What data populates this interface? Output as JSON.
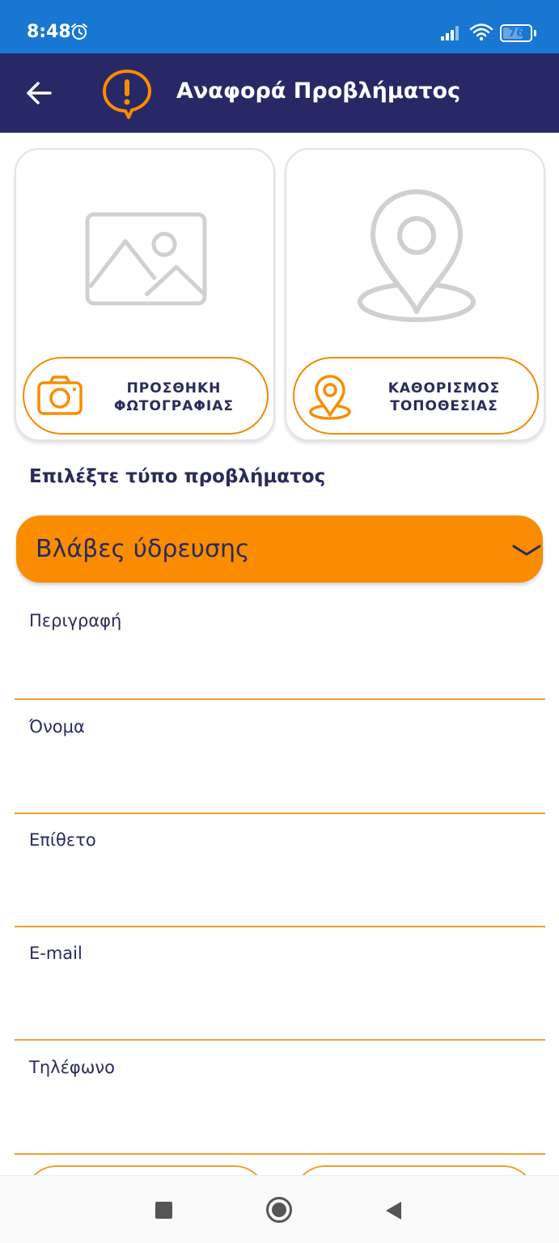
{
  "status_bar": {
    "time": "8:48",
    "battery": "76",
    "battery_level": 0.76,
    "icons": [
      "alarm-icon",
      "signal-icon",
      "wifi-icon",
      "battery-icon"
    ]
  },
  "app_bar": {
    "title": "Αναφορά Προβλήματος",
    "back_icon": "arrow-left-icon",
    "logo_icon": "exclamation-bubble-icon"
  },
  "photo_card": {
    "illustration": "image-placeholder-icon",
    "button_icon": "camera-icon",
    "label_line1": "ΠΡΟΣΘΗΚΗ",
    "label_line2": "ΦΩΤΟΓΡΑΦΙΑΣ"
  },
  "location_card": {
    "illustration": "map-pin-placeholder-icon",
    "button_icon": "map-pin-icon",
    "label_line1": "ΚΑΘΟΡΙΣΜΟΣ",
    "label_line2": "ΤΟΠΟΘΕΣΙΑΣ"
  },
  "problem_type": {
    "label": "Επιλέξτε τύπο προβλήματος",
    "selected": "Βλάβες ύδρευσης"
  },
  "form": {
    "description_label": "Περιγραφή",
    "first_name_label": "Όνομα",
    "last_name_label": "Επίθετο",
    "email_label": "E-mail",
    "phone_label": "Τηλέφωνο",
    "description_value": "",
    "first_name_value": "",
    "last_name_value": "",
    "email_value": "",
    "phone_value": ""
  },
  "colors": {
    "status_bar": "#1877d2",
    "app_bar": "#282866",
    "accent": "#f98c00",
    "text": "#2a2a5c"
  }
}
